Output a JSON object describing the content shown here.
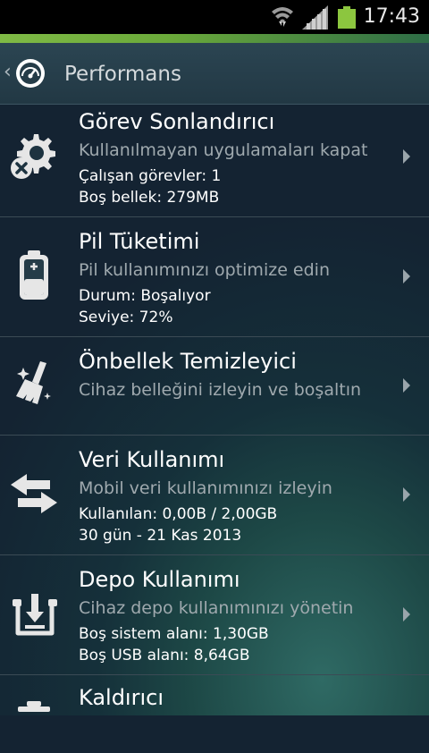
{
  "status_bar": {
    "time": "17:43",
    "icons": [
      "wifi-icon",
      "signal-icon",
      "battery-icon"
    ],
    "battery_color": "#8cc63f"
  },
  "app_bar": {
    "back_glyph": "‹",
    "title": "Performans"
  },
  "items": [
    {
      "title": "Görev Sonlandırıcı",
      "subtitle": "Kullanılmayan uygulamaları kapat",
      "line1": "Çalışan görevler: 1",
      "line2": "Boş bellek: 279MB",
      "icon": "task-killer-icon"
    },
    {
      "title": "Pil Tüketimi",
      "subtitle": "Pil kullanımınızı optimize edin",
      "line1": "Durum: Boşalıyor",
      "line2": "Seviye: 72%",
      "icon": "battery-icon"
    },
    {
      "title": "Önbellek Temizleyici",
      "subtitle": "Cihaz belleğini izleyin ve boşaltın",
      "icon": "broom-icon"
    },
    {
      "title": "Veri Kullanımı",
      "subtitle": "Mobil veri kullanımınızı izleyin",
      "line1": "Kullanılan: 0,00B / 2,00GB",
      "line2": "30 gün - 21 Kas 2013",
      "icon": "data-transfer-icon"
    },
    {
      "title": "Depo Kullanımı",
      "subtitle": "Cihaz depo kullanımınızı yönetin",
      "line1": "Boş sistem alanı: 1,30GB",
      "line2": "Boş USB alanı: 8,64GB",
      "icon": "storage-icon"
    },
    {
      "title": "Kaldırıcı",
      "icon": "uninstaller-icon"
    }
  ]
}
